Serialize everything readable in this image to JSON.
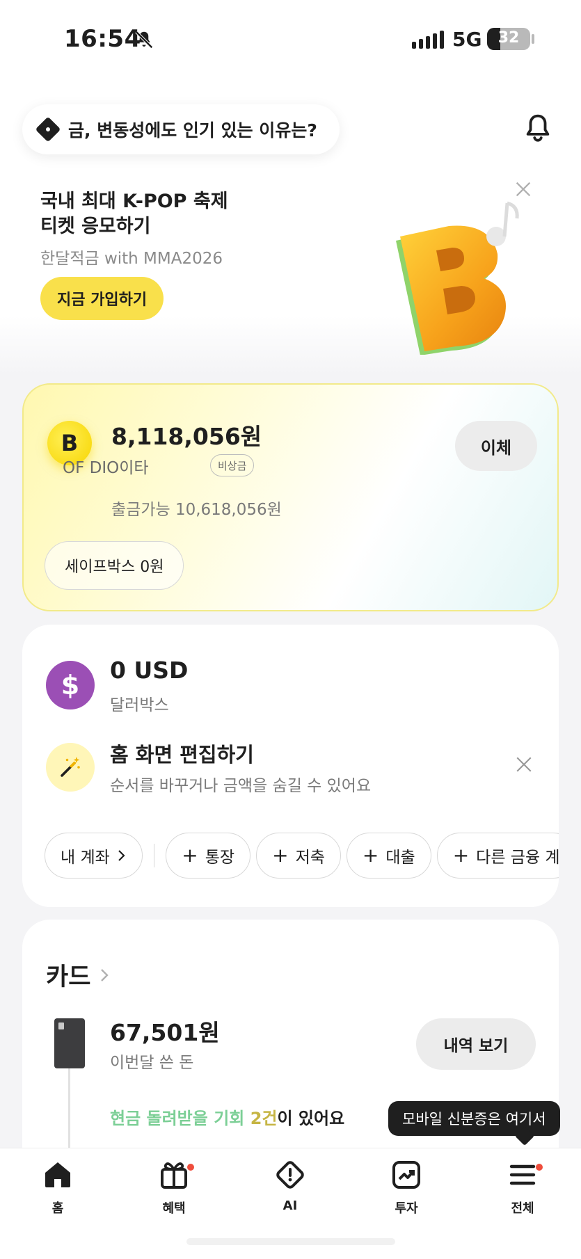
{
  "status_bar": {
    "time": "16:54",
    "network": "5G",
    "battery": "32"
  },
  "ai_banner": {
    "question": "금, 변동성에도 인기 있는 이유는?"
  },
  "promo": {
    "title_line1": "국내 최대 K-POP 축제",
    "title_line2": "티켓 응모하기",
    "subtitle": "한달적금 with MMA2026",
    "cta": "지금 가입하기"
  },
  "account": {
    "amount": "8,118,056원",
    "name": "OF DIO이타",
    "badge": "비상금",
    "available": "출금가능 10,618,056원",
    "transfer": "이체",
    "safebox": "세이프박스  0원"
  },
  "usd": {
    "amount": "0 USD",
    "label": "달러박스"
  },
  "edit_home": {
    "title": "홈 화면 편집하기",
    "subtitle": "순서를 바꾸거나 금액을 숨길 수 있어요"
  },
  "chips": {
    "my_accounts": "내 계좌",
    "bankbook": "통장",
    "savings": "저축",
    "loan": "대출",
    "other": "다른 금융 계"
  },
  "card": {
    "section_title": "카드",
    "amount": "67,501원",
    "label": "이번달 쓴 돈",
    "history": "내역 보기",
    "cashback_part1": "현금 돌려받을 기회 ",
    "cashback_part2": "2건",
    "cashback_part3": "이 있어요"
  },
  "tooltip": "모바일 신분증은 여기서",
  "tabs": {
    "home": "홈",
    "benefit": "혜택",
    "ai": "AI",
    "invest": "투자",
    "all": "전체"
  },
  "colors": {
    "accent_yellow": "#f9e04b",
    "usd_purple": "#9b4fb5",
    "notification_red": "#ef4d3c"
  }
}
